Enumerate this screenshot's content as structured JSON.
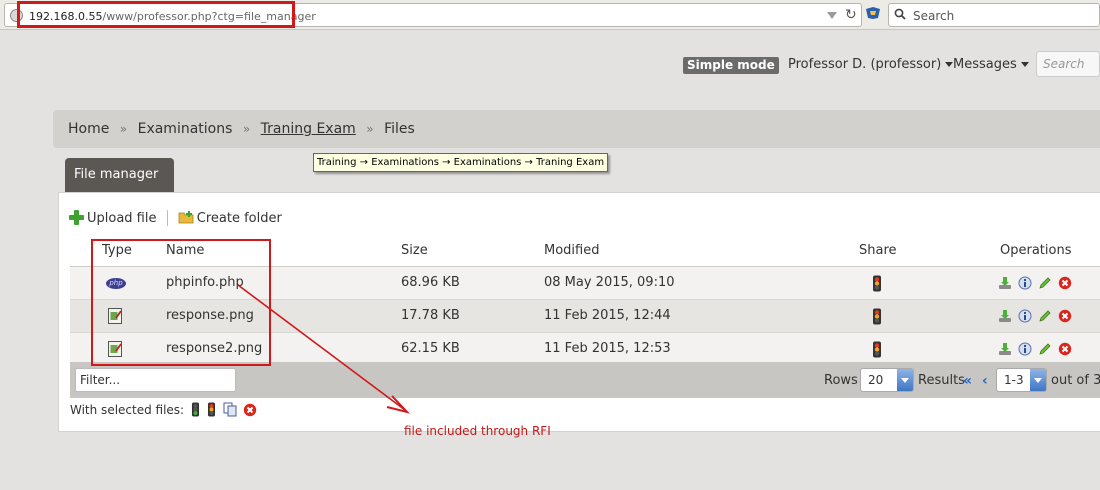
{
  "browser": {
    "url_host": "192.168.0.55",
    "url_path": "/www/professor.php?ctg=file_manager",
    "search_placeholder": "Search"
  },
  "topbar": {
    "simple_mode": "Simple mode",
    "user": "Professor D. (professor)",
    "messages": "Messages",
    "search_placeholder": "Search"
  },
  "breadcrumb": {
    "items": [
      "Home",
      "Examinations",
      "Traning Exam",
      "Files"
    ],
    "separator": "»"
  },
  "tooltip": "Training → Examinations → Examinations → Traning Exam",
  "tab": "File manager",
  "toolbar": {
    "upload": "Upload file",
    "create_folder": "Create folder"
  },
  "table": {
    "headers": [
      "Type",
      "Name",
      "Size",
      "Modified",
      "Share",
      "Operations"
    ],
    "rows": [
      {
        "type_icon": "php-file-icon",
        "type_label": "php",
        "name": "phpinfo.php",
        "size": "68.96 KB",
        "modified": "08 May 2015, 09:10"
      },
      {
        "type_icon": "image-file-icon",
        "name": "response.png",
        "size": "17.78 KB",
        "modified": "11 Feb 2015, 12:44"
      },
      {
        "type_icon": "image-file-icon",
        "name": "response2.png",
        "size": "62.15 KB",
        "modified": "11 Feb 2015, 12:53"
      }
    ]
  },
  "footer": {
    "filter_placeholder": "Filter...",
    "rows_label": "Rows",
    "rows_value": "20",
    "results_label": "Results",
    "results_value": "1-3",
    "outof": "out of 3",
    "with_selected": "With selected files:"
  },
  "annotation": {
    "text": "file included through RFI",
    "color": "#c01818"
  },
  "colors": {
    "tab_bg": "#5b5753",
    "accent_red": "#d01a1a",
    "link_blue": "#2266cc"
  }
}
